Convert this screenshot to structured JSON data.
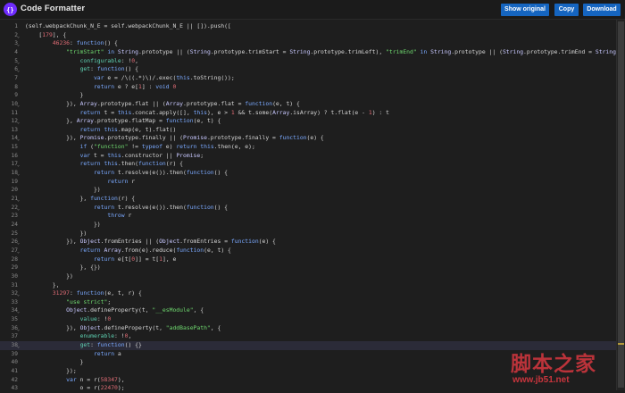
{
  "app": {
    "title": "Code Formatter"
  },
  "toolbar": {
    "show_original_label": "Show original",
    "copy_label": "Copy",
    "download_label": "Download"
  },
  "editor": {
    "active_line": 38,
    "lines": [
      {
        "n": "1",
        "fold": false,
        "code": "(self.webpackChunk_N_E = self.webpackChunk_N_E || []).push(["
      },
      {
        "n": "2",
        "fold": true,
        "code": "    [179], {"
      },
      {
        "n": "3",
        "fold": true,
        "code": "        46236: function() {"
      },
      {
        "n": "4",
        "fold": false,
        "code": "            \"trimStart\" in String.prototype || (String.prototype.trimStart = String.prototype.trimLeft), \"trimEnd\" in String.prototype || (String.prototype.trimEnd = String.pr"
      },
      {
        "n": "5",
        "fold": true,
        "code": "                configurable: !0,"
      },
      {
        "n": "6",
        "fold": true,
        "code": "                get: function() {"
      },
      {
        "n": "7",
        "fold": false,
        "code": "                    var e = /\\((.*)\\)/.exec(this.toString());"
      },
      {
        "n": "8",
        "fold": false,
        "code": "                    return e ? e[1] : void 0"
      },
      {
        "n": "9",
        "fold": false,
        "code": "                }"
      },
      {
        "n": "10",
        "fold": true,
        "code": "            }), Array.prototype.flat || (Array.prototype.flat = function(e, t) {"
      },
      {
        "n": "11",
        "fold": false,
        "code": "                return t = this.concat.apply([], this), e > 1 && t.some(Array.isArray) ? t.flat(e - 1) : t"
      },
      {
        "n": "12",
        "fold": true,
        "code": "            }, Array.prototype.flatMap = function(e, t) {"
      },
      {
        "n": "13",
        "fold": false,
        "code": "                return this.map(e, t).flat()"
      },
      {
        "n": "14",
        "fold": true,
        "code": "            }), Promise.prototype.finally || (Promise.prototype.finally = function(e) {"
      },
      {
        "n": "15",
        "fold": false,
        "code": "                if (\"function\" != typeof e) return this.then(e, e);"
      },
      {
        "n": "16",
        "fold": false,
        "code": "                var t = this.constructor || Promise;"
      },
      {
        "n": "17",
        "fold": true,
        "code": "                return this.then(function(r) {"
      },
      {
        "n": "18",
        "fold": true,
        "code": "                    return t.resolve(e()).then(function() {"
      },
      {
        "n": "19",
        "fold": false,
        "code": "                        return r"
      },
      {
        "n": "20",
        "fold": false,
        "code": "                    })"
      },
      {
        "n": "21",
        "fold": true,
        "code": "                }, function(r) {"
      },
      {
        "n": "22",
        "fold": true,
        "code": "                    return t.resolve(e()).then(function() {"
      },
      {
        "n": "23",
        "fold": false,
        "code": "                        throw r"
      },
      {
        "n": "24",
        "fold": false,
        "code": "                    })"
      },
      {
        "n": "25",
        "fold": false,
        "code": "                })"
      },
      {
        "n": "26",
        "fold": true,
        "code": "            }), Object.fromEntries || (Object.fromEntries = function(e) {"
      },
      {
        "n": "27",
        "fold": true,
        "code": "                return Array.from(e).reduce(function(e, t) {"
      },
      {
        "n": "28",
        "fold": false,
        "code": "                    return e[t[0]] = t[1], e"
      },
      {
        "n": "29",
        "fold": false,
        "code": "                }, {})"
      },
      {
        "n": "30",
        "fold": false,
        "code": "            })"
      },
      {
        "n": "31",
        "fold": false,
        "code": "        },"
      },
      {
        "n": "32",
        "fold": true,
        "code": "        31297: function(e, t, r) {"
      },
      {
        "n": "33",
        "fold": false,
        "code": "            \"use strict\";"
      },
      {
        "n": "34",
        "fold": true,
        "code": "            Object.defineProperty(t, \"__esModule\", {"
      },
      {
        "n": "35",
        "fold": false,
        "code": "                value: !0"
      },
      {
        "n": "36",
        "fold": true,
        "code": "            }), Object.defineProperty(t, \"addBasePath\", {"
      },
      {
        "n": "37",
        "fold": false,
        "code": "                enumerable: !0,"
      },
      {
        "n": "38",
        "fold": true,
        "code": "                get: function() {}"
      },
      {
        "n": "39",
        "fold": false,
        "code": "                    return a"
      },
      {
        "n": "40",
        "fold": false,
        "code": "                }"
      },
      {
        "n": "41",
        "fold": false,
        "code": "            });"
      },
      {
        "n": "42",
        "fold": false,
        "code": "            var n = r(58347),"
      },
      {
        "n": "43",
        "fold": false,
        "code": "                o = r(22470);"
      }
    ]
  },
  "watermark": {
    "title": "脚本之家",
    "url": "www.jb51.net"
  },
  "colors": {
    "accent": "#1565c0",
    "logo": "#6f2cff",
    "watermark": "#c9353d"
  }
}
